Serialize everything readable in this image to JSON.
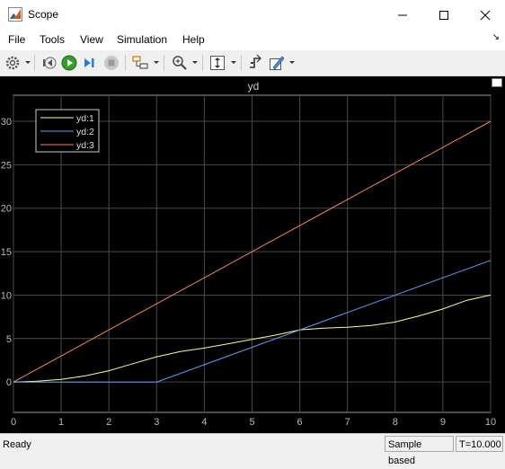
{
  "window": {
    "title": "Scope"
  },
  "menu": {
    "items": [
      "File",
      "Tools",
      "View",
      "Simulation",
      "Help"
    ]
  },
  "toolbar": {
    "icons": [
      "gear-icon",
      "step-back-icon",
      "run-icon",
      "step-forward-icon",
      "stop-icon",
      "signal-select-icon",
      "zoom-icon",
      "autoscale-icon",
      "triggers-icon",
      "style-icon"
    ]
  },
  "status": {
    "ready": "Ready",
    "mode": "Sample based",
    "time": "T=10.000"
  },
  "chart_data": {
    "type": "line",
    "title": "yd",
    "xlabel": "",
    "ylabel": "",
    "xlim": [
      0,
      10
    ],
    "ylim": [
      -3.5,
      33
    ],
    "xticks": [
      0,
      1,
      2,
      3,
      4,
      5,
      6,
      7,
      8,
      9,
      10
    ],
    "yticks": [
      0,
      5,
      10,
      15,
      20,
      25,
      30
    ],
    "grid": true,
    "legend": "top-left",
    "series": [
      {
        "name": "yd:1",
        "color": "#ffff80",
        "x": [
          0,
          0.5,
          1,
          1.5,
          2,
          2.5,
          3,
          3.5,
          4,
          4.5,
          5,
          5.5,
          6,
          6.5,
          7,
          7.5,
          8,
          8.5,
          9,
          9.5,
          10
        ],
        "y": [
          0,
          0.1,
          0.3,
          0.7,
          1.3,
          2.1,
          2.9,
          3.5,
          3.9,
          4.4,
          4.9,
          5.4,
          6,
          6.2,
          6.3,
          6.5,
          6.9,
          7.6,
          8.4,
          9.4,
          10
        ]
      },
      {
        "name": "yd:2",
        "color": "#4da6ff",
        "x": [
          0,
          3,
          10
        ],
        "y": [
          0,
          0,
          14
        ]
      },
      {
        "name": "yd:3",
        "color": "#ff7f50",
        "x": [
          0,
          10
        ],
        "y": [
          0,
          30
        ]
      }
    ]
  }
}
